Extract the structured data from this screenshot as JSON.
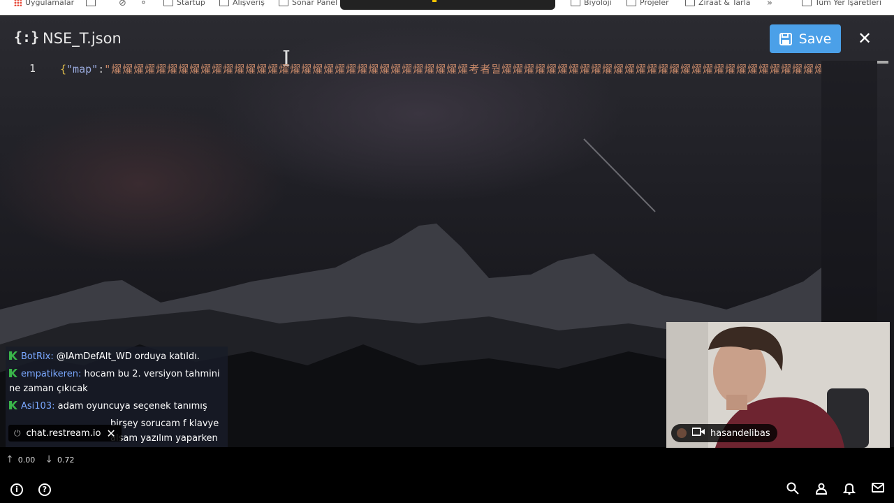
{
  "bookmarks": {
    "items": [
      "Uygulamalar",
      "Startup",
      "Alışveriş",
      "Sonar Panel",
      "Biyoloji",
      "Projeler",
      "Ziraat & Tarla",
      "Tüm Yer İşaretleri"
    ],
    "more": "»"
  },
  "editor": {
    "file_icon": "{:}",
    "file_name": "NSE_T.json",
    "save_label": "Save",
    "close_label": "✕",
    "line_number": "1",
    "code": {
      "open_brace": "{",
      "key": "\"map\"",
      "colon": ":",
      "value": "\"燿燿燿燿燿燿燿燿燿燿燿燿燿燿燿燿燿燿燿燿燿燿燿燿燿燿燿燿燿燿燿燿考者뭘燿燿燿燿燿燿燿燿燿燿燿燿燿燿燿燿燿燿燿燿燿燿燿燿燿燿燿燿燿燿燿燿"
    }
  },
  "chat": {
    "messages": [
      {
        "user": "BotRix",
        "text": "@IAmDefAlt_WD orduya katıldı."
      },
      {
        "user": "empatikeren",
        "text": "hocam bu 2. versiyon tahmini ne zaman çıkıcak"
      },
      {
        "user": "Asi103",
        "text": "adam oyuncuya seçenek tanımış"
      },
      {
        "user": "",
        "text": "birşey sorucam f klavye alsam yazılım yaparken daha rahatlık sağlar"
      }
    ],
    "source": "chat.restream.io"
  },
  "webcam": {
    "username": "hasandelibas"
  },
  "stats": {
    "up": "0.00",
    "down": "0.72"
  },
  "bottom_icons": [
    "info-icon",
    "help-icon",
    "search-icon",
    "user-icon",
    "bell-icon",
    "mail-icon"
  ],
  "colors": {
    "save_button": "#4ba0e8",
    "chat_user": "#7aa8ff",
    "chat_badge": "#3ab54a"
  }
}
